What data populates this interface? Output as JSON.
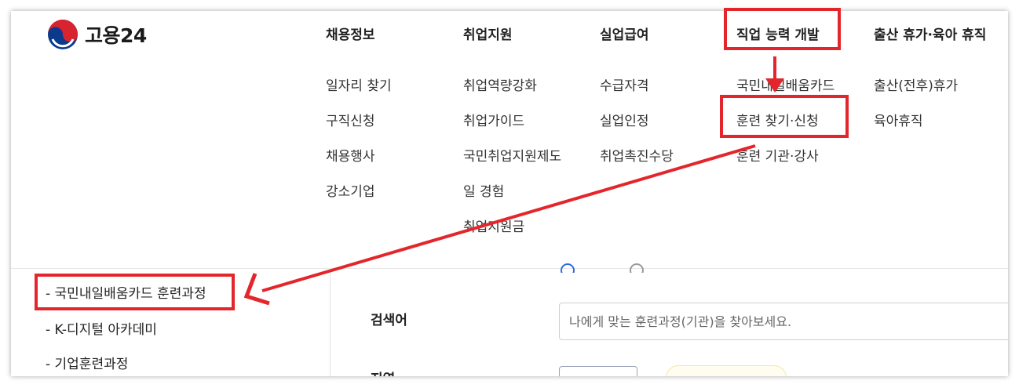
{
  "logo": {
    "text": "고용24"
  },
  "nav": [
    {
      "label": "채용정보",
      "items": [
        "일자리 찾기",
        "구직신청",
        "채용행사",
        "강소기업"
      ]
    },
    {
      "label": "취업지원",
      "items": [
        "취업역량강화",
        "취업가이드",
        "국민취업지원제도",
        "일 경험",
        "취업지원금"
      ]
    },
    {
      "label": "실업급여",
      "items": [
        "수급자격",
        "실업인정",
        "취업촉진수당"
      ]
    },
    {
      "label": "직업 능력 개발",
      "items": [
        "국민내일배움카드",
        "훈련 찾기·신청",
        "훈련 기관·강사"
      ]
    },
    {
      "label": "출산 휴가·육아 휴직",
      "items": [
        "출산(전후)휴가",
        "육아휴직"
      ]
    }
  ],
  "sidebar": {
    "items": [
      "- 국민내일배움카드 훈련과정",
      "- K-디지털 아카데미",
      "- 기업훈련과정"
    ]
  },
  "search": {
    "label": "검색어",
    "placeholder": "나에게 맞는 훈련과정(기관)을 찾아보세요.",
    "region_label": "지역"
  },
  "colors": {
    "highlight": "#e3262b",
    "radio": "#2f6bd9"
  }
}
